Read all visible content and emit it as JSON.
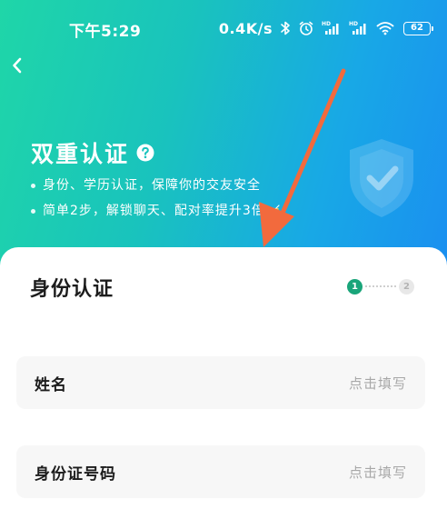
{
  "status_bar": {
    "time": "下午5:29",
    "network_speed": "0.4K/s",
    "battery_level": "62",
    "icons": [
      "bluetooth-icon",
      "alarm-icon",
      "hd-signal-icon",
      "hd-signal-icon",
      "wifi-icon",
      "battery-icon"
    ]
  },
  "header": {
    "back_icon": "chevron-left-icon",
    "title": "双重认证",
    "help_icon": "question-circle-icon",
    "bullets": [
      "身份、学历认证，保障你的交友安全",
      "简单2步，解锁聊天、配对率提升3倍"
    ],
    "decoration_icon": "shield-check-icon"
  },
  "card": {
    "title": "身份认证",
    "steps": {
      "step1": "1",
      "step2": "2",
      "current": 1
    },
    "fields": [
      {
        "label": "姓名",
        "placeholder": "点击填写"
      },
      {
        "label": "身份证号码",
        "placeholder": "点击填写"
      }
    ]
  },
  "colors": {
    "gradient_start": "#1fd6a8",
    "gradient_end": "#1a8ff0",
    "step_active": "#1aa57a",
    "annotation_arrow": "#f26a3d",
    "placeholder_text": "#a8a8a8"
  }
}
